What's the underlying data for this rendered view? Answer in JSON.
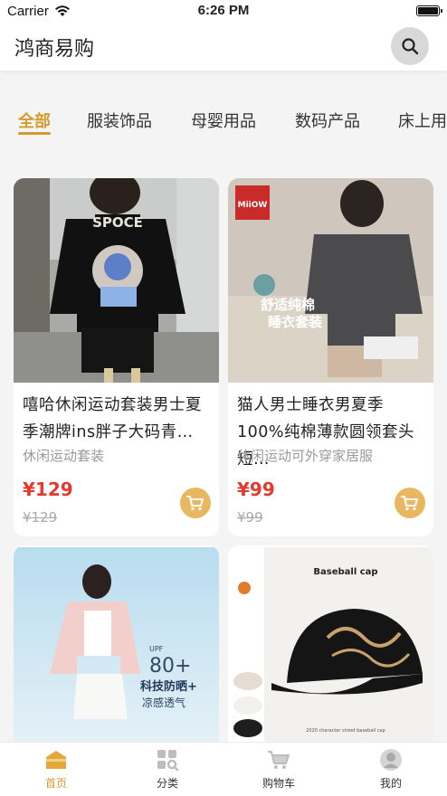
{
  "status_bar": {
    "carrier": "Carrier",
    "time": "6:26 PM"
  },
  "header": {
    "title": "鸿商易购",
    "search_icon": "search-icon"
  },
  "categories": [
    {
      "label": "全部",
      "active": true
    },
    {
      "label": "服装饰品",
      "active": false
    },
    {
      "label": "母婴用品",
      "active": false
    },
    {
      "label": "数码产品",
      "active": false
    },
    {
      "label": "床上用",
      "active": false
    }
  ],
  "products": [
    {
      "title": "嘻哈休闲运动套装男士夏季潮牌ins胖子大码青…",
      "subtitle": "休闲运动套装",
      "price": "¥129",
      "original_price": "¥129",
      "image_text": "SPOCE"
    },
    {
      "title": "猫人男士睡衣男夏季100%纯棉薄款圆领套头短…",
      "subtitle": "休闲运动可外穿家居服",
      "price": "¥99",
      "original_price": "¥99",
      "image_text": [
        "MiiOW",
        "舒适纯棉",
        "睡衣套装"
      ]
    },
    {
      "image_text": [
        "UPF",
        "80+",
        "科技防晒+",
        "凉感透气"
      ]
    },
    {
      "image_text": [
        "Baseball cap",
        "2020 character street baseball cap"
      ]
    }
  ],
  "tabbar": [
    {
      "label": "首页",
      "icon": "home-icon",
      "active": true
    },
    {
      "label": "分类",
      "icon": "category-icon",
      "active": false
    },
    {
      "label": "购物车",
      "icon": "cart-icon",
      "active": false
    },
    {
      "label": "我的",
      "icon": "profile-icon",
      "active": false
    }
  ],
  "colors": {
    "accent": "#d39b2c",
    "price": "#e23a2e",
    "cart_button": "#e9b760"
  }
}
